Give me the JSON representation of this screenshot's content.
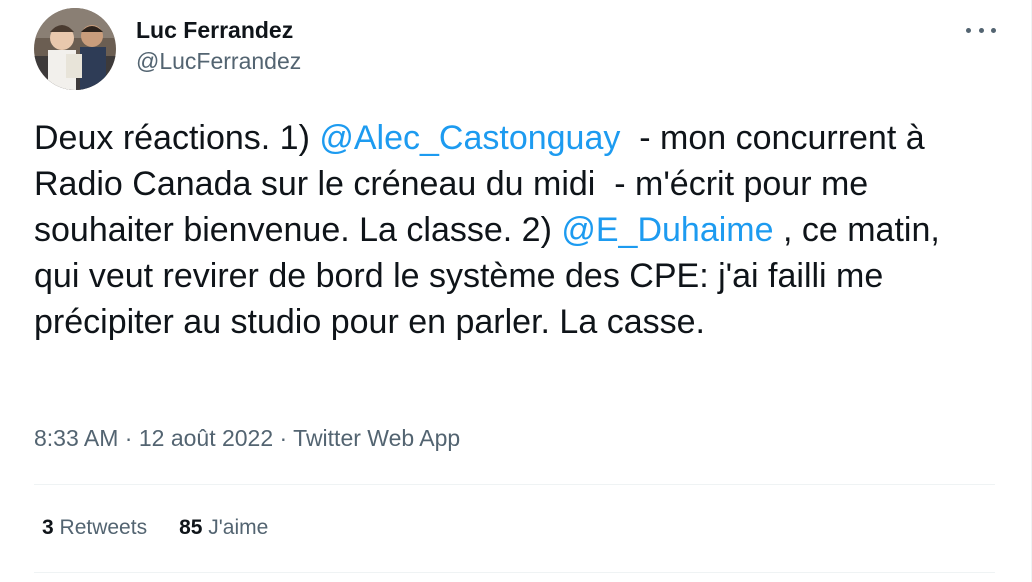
{
  "author": {
    "display_name": "Luc Ferrandez",
    "handle": "@LucFerrandez"
  },
  "tweet": {
    "segments": [
      {
        "type": "text",
        "text": "Deux réactions. 1) "
      },
      {
        "type": "mention",
        "text": "@Alec_Castonguay"
      },
      {
        "type": "text",
        "text": "  - mon concurrent à Radio Canada sur le créneau du midi  - m'écrit pour me souhaiter bienvenue. La classe. 2) "
      },
      {
        "type": "mention",
        "text": "@E_Duhaime"
      },
      {
        "type": "text",
        "text": " , ce matin,  qui veut revirer de bord le système des CPE: j'ai failli me précipiter au studio pour en parler. La casse."
      }
    ]
  },
  "meta": {
    "time": "8:33 AM",
    "sep1": " · ",
    "date": "12 août 2022",
    "sep2": " · ",
    "source": "Twitter Web App"
  },
  "stats": {
    "retweets_count": "3",
    "retweets_label": "Retweets",
    "likes_count": "85",
    "likes_label": "J'aime"
  },
  "icons": {
    "more": "more-horizontal-icon"
  },
  "colors": {
    "mention": "#1d9bf0",
    "secondary": "#536471",
    "primary": "#0f1419",
    "divider": "#eff3f4"
  }
}
